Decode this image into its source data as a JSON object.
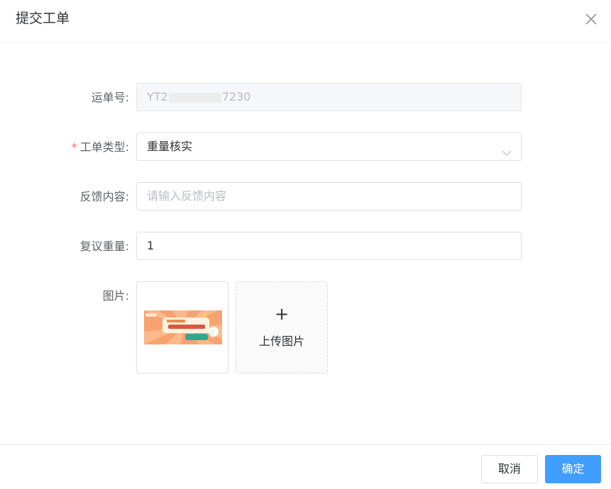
{
  "dialog": {
    "title": "提交工单",
    "close_icon": "close-icon"
  },
  "form": {
    "waybill": {
      "label": "运单号:",
      "value_prefix": "YT2",
      "value_suffix": "7230"
    },
    "ticket_type": {
      "required_mark": "*",
      "label": "工单类型:",
      "value": "重量核实",
      "icon": "chevron-down-icon"
    },
    "feedback": {
      "label": "反馈内容:",
      "placeholder": "请输入反馈内容"
    },
    "reweight": {
      "label": "复议重量:",
      "value": "1"
    },
    "images": {
      "label": "图片:",
      "upload_icon": "+",
      "upload_label": "上传图片"
    }
  },
  "footer": {
    "cancel_label": "取消",
    "ok_label": "确定"
  },
  "colors": {
    "primary": "#409eff",
    "required": "#f56c6c",
    "border": "#dcdfe6"
  }
}
